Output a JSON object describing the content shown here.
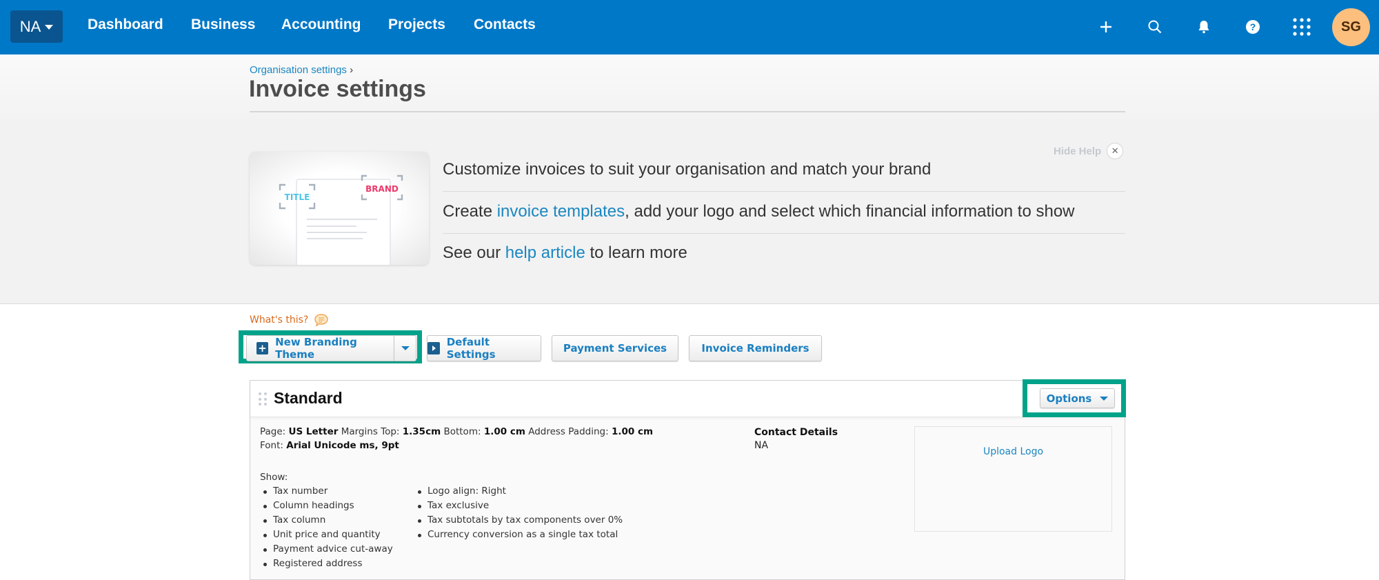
{
  "topnav": {
    "org_label": "NA",
    "items": [
      {
        "label": "Dashboard"
      },
      {
        "label": "Business"
      },
      {
        "label": "Accounting"
      },
      {
        "label": "Projects"
      },
      {
        "label": "Contacts"
      }
    ],
    "icons": [
      "plus-icon",
      "search-icon",
      "bell-icon",
      "help-icon",
      "apps-grid-icon"
    ],
    "avatar_initials": "SG",
    "colors": {
      "bar": "#0078c8",
      "org_button": "#0a5590",
      "avatar": "#fcbf7d"
    }
  },
  "header": {
    "breadcrumb_link": "Organisation settings",
    "breadcrumb_sep": "›",
    "title": "Invoice settings"
  },
  "help": {
    "hide_label": "Hide Help",
    "image_labels": {
      "title": "TITLE",
      "brand": "BRAND"
    },
    "line1": "Customize invoices to suit your organisation and match your brand",
    "line2_pre": "Create ",
    "line2_link": "invoice templates",
    "line2_post": ", add your logo and select which financial information to show",
    "line3_pre": "See our ",
    "line3_link": "help article",
    "line3_post": " to learn more"
  },
  "toolbar": {
    "whats_this": "What's this?",
    "new_branding_theme": "New Branding Theme",
    "default_settings": "Default Settings",
    "payment_services": "Payment Services",
    "invoice_reminders": "Invoice Reminders",
    "highlight_color": "#00a38a",
    "accent": "#1a7fc0"
  },
  "theme": {
    "name": "Standard",
    "options_label": "Options",
    "page_label": "Page:",
    "page_value": "US Letter",
    "margins_top_label": "Margins Top:",
    "margins_top_value": "1.35cm",
    "bottom_label": "Bottom:",
    "bottom_value": "1.00 cm",
    "address_padding_label": "Address Padding:",
    "address_padding_value": "1.00 cm",
    "font_label": "Font:",
    "font_value": "Arial Unicode ms, 9pt",
    "show_label": "Show:",
    "show_col1": [
      "Tax number",
      "Column headings",
      "Tax column",
      "Unit price and quantity",
      "Payment advice cut-away",
      "Registered address"
    ],
    "show_col2": [
      "Logo align: Right",
      "Tax exclusive",
      "Tax subtotals by tax components over 0%",
      "Currency conversion as a single tax total"
    ],
    "contact_heading": "Contact Details",
    "contact_value": "NA",
    "upload_logo": "Upload Logo"
  }
}
